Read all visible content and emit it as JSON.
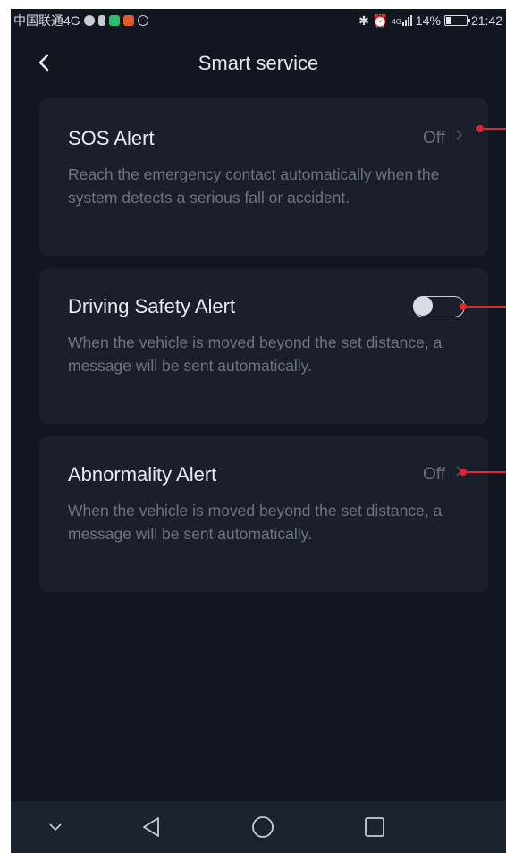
{
  "status_bar": {
    "carrier": "中国联通4G",
    "signal_text": "4G",
    "battery_percent": "14%",
    "time": "21:42"
  },
  "header": {
    "back_icon": "chevron-left-icon",
    "title": "Smart service"
  },
  "cards": [
    {
      "title": "SOS Alert",
      "status": "Off",
      "status_icon": "chevron-right-icon",
      "description": "Reach the emergency contact automatically when the system detects a serious fall or accident."
    },
    {
      "title": "Driving Safety Alert",
      "toggle_state": "off",
      "description": "When the vehicle is moved beyond the set distance, a message will be sent automatically."
    },
    {
      "title": "Abnormality Alert",
      "status": "Off",
      "status_icon": "chevron-right-icon",
      "description": "When the vehicle is moved beyond the set distance, a message will be sent automatically."
    }
  ],
  "nav_bar": {
    "items": [
      "chevron-down-icon",
      "back-triangle-icon",
      "home-circle-icon",
      "recents-square-icon"
    ]
  },
  "colors": {
    "background": "#121621",
    "card": "#1a1f2c",
    "annotation": "#e0262e"
  }
}
